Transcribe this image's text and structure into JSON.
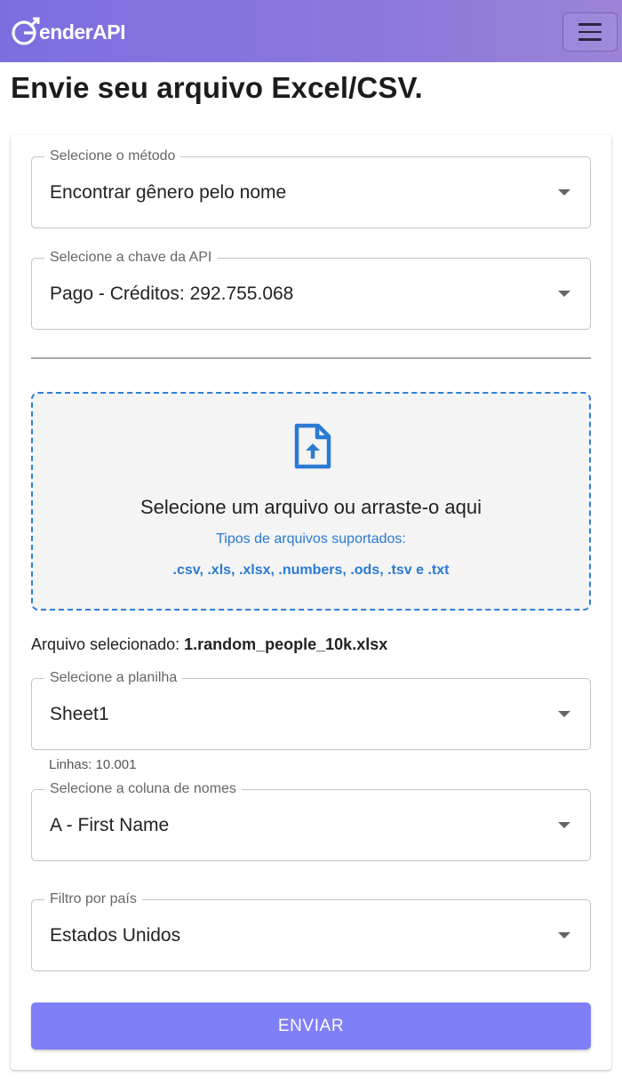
{
  "header": {
    "logo_text": "enderAPI",
    "logo_icon": "genderapi-logo-icon",
    "menu_icon": "hamburger-menu-icon",
    "background": "#8c78dc"
  },
  "page": {
    "title": "Envie seu arquivo Excel/CSV."
  },
  "form": {
    "method": {
      "label": "Selecione o método",
      "value": "Encontrar gênero pelo nome"
    },
    "api_key": {
      "label": "Selecione a chave da API",
      "value": "Pago - Créditos: 292.755.068"
    },
    "dropzone": {
      "icon": "file-upload-icon",
      "title": "Selecione um arquivo ou arraste-o aqui",
      "subtitle": "Tipos de arquivos suportados:",
      "types": ".csv, .xls, .xlsx, .numbers, .ods, .tsv e .txt",
      "accent": "#2f7fd6"
    },
    "selected_file": {
      "label": "Arquivo selecionado:",
      "name": "1.random_people_10k.xlsx"
    },
    "sheet": {
      "label": "Selecione a planilha",
      "value": "Sheet1",
      "helper": "Linhas: 10.001"
    },
    "name_column": {
      "label": "Selecione a coluna de nomes",
      "value": "A - First Name"
    },
    "country": {
      "label": "Filtro por país",
      "value": "Estados Unidos"
    },
    "submit": {
      "label": "ENVIAR",
      "color": "#7f7ff7"
    }
  }
}
